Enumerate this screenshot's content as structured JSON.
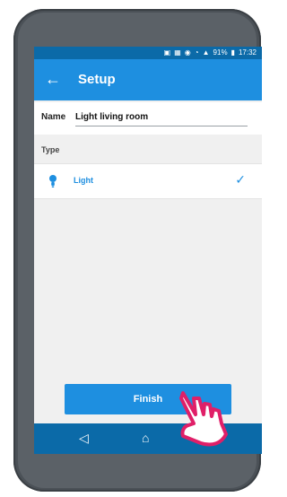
{
  "status_bar": {
    "time": "17:32",
    "battery": "91%"
  },
  "app_bar": {
    "title": "Setup",
    "back_icon": "arrow-left-icon"
  },
  "form": {
    "name_label": "Name",
    "name_value": "Light living room",
    "type_label": "Type",
    "type_options": [
      {
        "label": "Light",
        "icon": "bulb-icon",
        "selected": true
      }
    ]
  },
  "actions": {
    "finish_label": "Finish"
  },
  "nav": {
    "back_icon": "◁",
    "home_icon": "⌂"
  },
  "colors": {
    "accent": "#1e8fe0",
    "status": "#0b6aa8",
    "background": "#f0f0f0"
  }
}
